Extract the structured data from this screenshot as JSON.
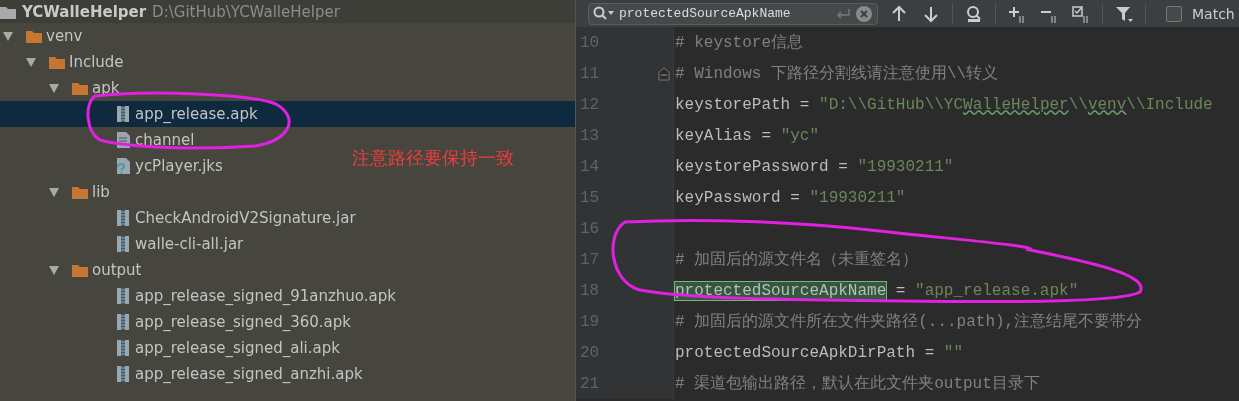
{
  "project": {
    "name": "YCWalleHelper",
    "path": "D:\\GitHub\\YCWalleHelper"
  },
  "tree": [
    {
      "label": "venv",
      "kind": "folder",
      "expanded": true,
      "selected": false,
      "children": [
        {
          "label": "Include",
          "kind": "folder",
          "expanded": true,
          "selected": false,
          "children": [
            {
              "label": "apk",
              "kind": "folder",
              "expanded": true,
              "selected": false,
              "children": [
                {
                  "label": "app_release.apk",
                  "kind": "archive",
                  "selected": true
                },
                {
                  "label": "channel",
                  "kind": "text",
                  "selected": false
                },
                {
                  "label": "ycPlayer.jks",
                  "kind": "unknown",
                  "selected": false
                }
              ]
            },
            {
              "label": "lib",
              "kind": "folder",
              "expanded": true,
              "selected": false,
              "children": [
                {
                  "label": "CheckAndroidV2Signature.jar",
                  "kind": "archive",
                  "selected": false
                },
                {
                  "label": "walle-cli-all.jar",
                  "kind": "archive",
                  "selected": false
                }
              ]
            },
            {
              "label": "output",
              "kind": "folder",
              "expanded": true,
              "selected": false,
              "children": [
                {
                  "label": "app_release_signed_91anzhuo.apk",
                  "kind": "archive",
                  "selected": false
                },
                {
                  "label": "app_release_signed_360.apk",
                  "kind": "archive",
                  "selected": false
                },
                {
                  "label": "app_release_signed_ali.apk",
                  "kind": "archive",
                  "selected": false
                },
                {
                  "label": "app_release_signed_anzhi.apk",
                  "kind": "archive",
                  "selected": false
                }
              ]
            }
          ]
        }
      ]
    }
  ],
  "note": "注意路径要保持一致",
  "search": {
    "value": "protectedSourceApkName",
    "match_case": {
      "label": "Match",
      "checked": false
    }
  },
  "code": [
    {
      "number": "10",
      "fold": false,
      "segments": [
        {
          "kind": "comment",
          "text": "# keystore信息"
        }
      ]
    },
    {
      "number": "11",
      "fold": true,
      "segments": [
        {
          "kind": "comment",
          "text": "# Windows 下路径分割线请注意使用\\\\转义"
        }
      ]
    },
    {
      "number": "12",
      "fold": false,
      "segments": [
        {
          "kind": "plain",
          "text": "keystorePath = "
        },
        {
          "kind": "string",
          "text": "\"D:\\\\GitHub\\\\YC"
        },
        {
          "kind": "typo",
          "text": "WalleHelper"
        },
        {
          "kind": "string",
          "text": "\\\\"
        },
        {
          "kind": "typo",
          "text": "venv"
        },
        {
          "kind": "string",
          "text": "\\\\Include"
        }
      ]
    },
    {
      "number": "13",
      "fold": false,
      "segments": [
        {
          "kind": "plain",
          "text": "keyAlias = "
        },
        {
          "kind": "string",
          "text": "\"yc\""
        }
      ]
    },
    {
      "number": "14",
      "fold": false,
      "segments": [
        {
          "kind": "plain",
          "text": "keystorePassword = "
        },
        {
          "kind": "string",
          "text": "\"19930211\""
        }
      ]
    },
    {
      "number": "15",
      "fold": false,
      "segments": [
        {
          "kind": "plain",
          "text": "keyPassword = "
        },
        {
          "kind": "string",
          "text": "\"19930211\""
        }
      ]
    },
    {
      "number": "16",
      "fold": false
    },
    {
      "number": "17",
      "fold": false,
      "segments": [
        {
          "kind": "comment",
          "text": "# 加固后的源文件名（未重签名）"
        }
      ]
    },
    {
      "number": "18",
      "fold": false,
      "segments": [
        {
          "kind": "match",
          "text": "protectedSourceApkName"
        },
        {
          "kind": "plain",
          "text": " = "
        },
        {
          "kind": "string",
          "text": "\"app_release.apk\""
        }
      ]
    },
    {
      "number": "19",
      "fold": false,
      "segments": [
        {
          "kind": "comment",
          "text": "# 加固后的源文件所在文件夹路径(...path),注意结尾不要带分"
        }
      ]
    },
    {
      "number": "20",
      "fold": false,
      "segments": [
        {
          "kind": "plain",
          "text": "protectedSourceApkDirPath = "
        },
        {
          "kind": "string",
          "text": "\"\""
        }
      ]
    },
    {
      "number": "21",
      "fold": false,
      "segments": [
        {
          "kind": "comment",
          "text": "# 渠道包输出路径，默认在此文件夹output目录下"
        }
      ]
    }
  ]
}
